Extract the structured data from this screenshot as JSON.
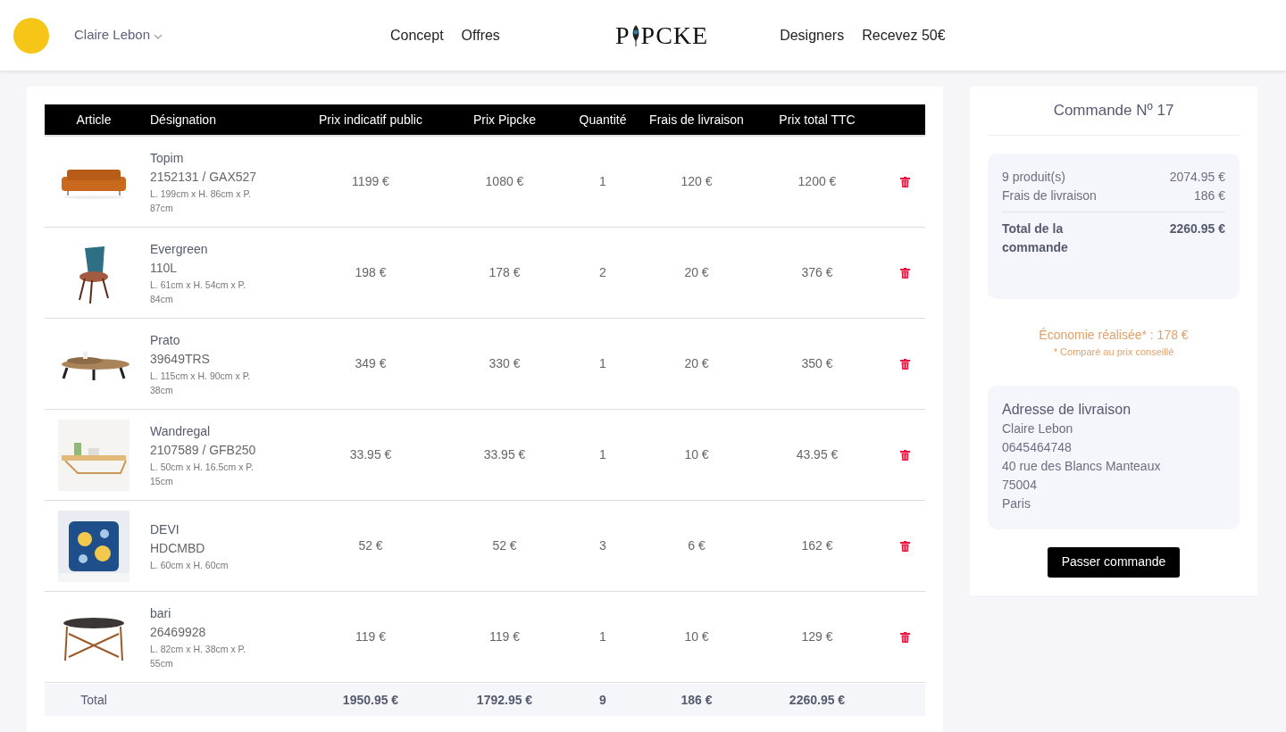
{
  "header": {
    "user_name": "Claire Lebon",
    "nav_left": [
      "Concept",
      "Offres"
    ],
    "logo": {
      "before": "P",
      "after": "PCKE"
    },
    "nav_right": [
      "Designers",
      "Recevez 50€"
    ]
  },
  "table": {
    "columns": [
      "Article",
      "Désignation",
      "Prix indicatif public",
      "Prix Pipcke",
      "Quantité",
      "Frais de livraison",
      "Prix total TTC"
    ],
    "rows": [
      {
        "name": "Topim",
        "ref": "2152131 / GAX527",
        "dimensions": "L. 199cm x H. 86cm x P. 87cm",
        "public_price": "1199 €",
        "pipcke_price": "1080 €",
        "quantity": "1",
        "delivery": "120 €",
        "total": "1200 €"
      },
      {
        "name": "Evergreen",
        "ref": "110L",
        "dimensions": "L. 61cm x H. 54cm x P. 84cm",
        "public_price": "198 €",
        "pipcke_price": "178 €",
        "quantity": "2",
        "delivery": "20 €",
        "total": "376 €"
      },
      {
        "name": "Prato",
        "ref": "39649TRS",
        "dimensions": "L. 115cm x H. 90cm x P. 38cm",
        "public_price": "349 €",
        "pipcke_price": "330 €",
        "quantity": "1",
        "delivery": "20 €",
        "total": "350 €"
      },
      {
        "name": "Wandregal",
        "ref": "2107589 / GFB250",
        "dimensions": "L. 50cm x H. 16.5cm x P. 15cm",
        "public_price": "33.95 €",
        "pipcke_price": "33.95 €",
        "quantity": "1",
        "delivery": "10 €",
        "total": "43.95 €"
      },
      {
        "name": "DEVI",
        "ref": "HDCMBD",
        "dimensions": "L. 60cm x H. 60cm",
        "public_price": "52 €",
        "pipcke_price": "52 €",
        "quantity": "3",
        "delivery": "6 €",
        "total": "162 €"
      },
      {
        "name": "bari",
        "ref": "26469928",
        "dimensions": "L. 82cm x H. 38cm x P. 55cm",
        "public_price": "119 €",
        "pipcke_price": "119 €",
        "quantity": "1",
        "delivery": "10 €",
        "total": "129 €"
      }
    ],
    "total_row": {
      "label": "Total",
      "public_price": "1950.95 €",
      "pipcke_price": "1792.95 €",
      "quantity": "9",
      "delivery": "186 €",
      "total": "2260.95 €"
    }
  },
  "summary": {
    "title": "Commande Nº 17",
    "lines": [
      {
        "label": "9 produit(s)",
        "value": "2074.95 €"
      },
      {
        "label": "Frais de livraison",
        "value": "186 €"
      }
    ],
    "total_label": "Total de la commande",
    "total_value": "2260.95 €",
    "savings": "Économie réalisée* : 178 €",
    "savings_note": "* Comparé au prix conseillé",
    "address": {
      "title": "Adresse de livraison",
      "lines": [
        "Claire Lebon",
        "0645464748",
        "40 rue des Blancs Manteaux",
        "75004",
        "Paris"
      ]
    },
    "button": "Passer commande"
  }
}
